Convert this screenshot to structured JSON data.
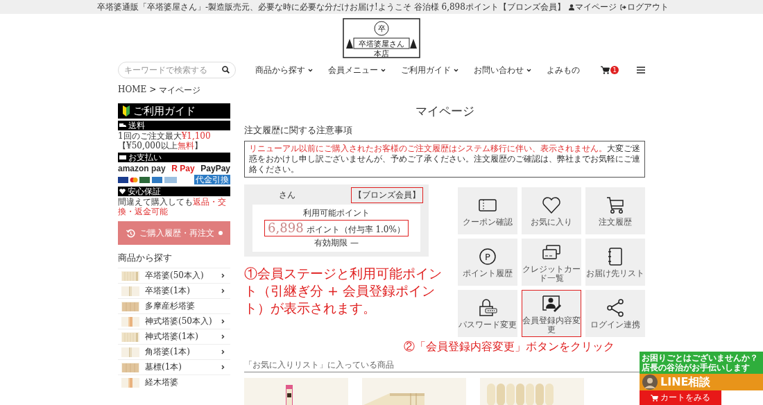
{
  "top_bar": {
    "tagline": "卒塔婆通販「卒塔婆屋さん」-製造販売元、必要な時に必要な分だけお届け!",
    "welcome": "ようこそ 谷治様 6,898ポイント【ブロンズ会員】",
    "links": [
      "マイページ",
      "ログアウト"
    ]
  },
  "logo": {
    "mark": "卒",
    "name": "卒塔婆屋さん",
    "branch": "本店"
  },
  "search": {
    "placeholder": "キーワードで検索する"
  },
  "nav": [
    {
      "label": "商品から探す",
      "dropdown": true
    },
    {
      "label": "会員メニュー",
      "dropdown": true
    },
    {
      "label": "ご利用ガイド",
      "dropdown": true
    },
    {
      "label": "お問い合わせ",
      "dropdown": true
    },
    {
      "label": "よみもの",
      "dropdown": false
    }
  ],
  "cart": {
    "count": "1"
  },
  "breadcrumb": {
    "items": [
      "HOME",
      "マイページ"
    ],
    "separator": ">"
  },
  "guide": {
    "title": "ご利用ガイド",
    "sections": [
      {
        "kind": "text",
        "heading": "送料",
        "segments": [
          {
            "text": "1回のご注文最大",
            "red": false
          },
          {
            "text": "¥1,100",
            "red": true
          },
          {
            "text": "【¥50,000以上",
            "red": false
          },
          {
            "text": "無料",
            "red": true
          },
          {
            "text": "】",
            "red": false
          }
        ]
      },
      {
        "kind": "payments",
        "heading": "お支払い",
        "wallets": [
          "amazon pay",
          "R Pay",
          "PayPay"
        ],
        "cod": "代金引換"
      },
      {
        "kind": "text",
        "heading": "安心保証",
        "segments": [
          {
            "text": "間違えて購入しても",
            "red": false
          },
          {
            "text": "返品・交換・返金可能",
            "red": true
          }
        ]
      }
    ]
  },
  "reorder_button": "ご購入履歴・再注文",
  "categories": {
    "heading": "商品から探す",
    "items": [
      {
        "name": "卒塔婆(50本入)",
        "arrow": true
      },
      {
        "name": "卒塔婆(1本)",
        "arrow": true
      },
      {
        "name": "多摩産杉塔婆",
        "arrow": false
      },
      {
        "name": "神式塔婆(50本入)",
        "arrow": true
      },
      {
        "name": "神式塔婆(1本)",
        "arrow": true
      },
      {
        "name": "角塔婆(1本)",
        "arrow": true
      },
      {
        "name": "墓標(1本)",
        "arrow": true
      },
      {
        "name": "経木塔婆",
        "arrow": false
      }
    ]
  },
  "page_title": "マイページ",
  "notice": {
    "heading": "注文履歴に関する注意事項",
    "segments": [
      {
        "text": "リニューアル以前にご購入されたお客様のご注文履歴はシステム移行に伴い、表示されません。",
        "red": true
      },
      {
        "text": "大変ご迷惑をおかけし申し訳ございませんが、予めご了承ください。注文履歴のご確認は、弊社までお気軽にご連絡ください。",
        "red": false
      }
    ]
  },
  "member": {
    "name_suffix": "さん",
    "rank": "【ブロンズ会員】",
    "rank_highlighted": true,
    "points_label": "利用可能ポイント",
    "points": "6,898",
    "points_highlighted": true,
    "points_unit": "ポイント（付与率 1.0%）",
    "expiry": "有効期限 —"
  },
  "tiles": [
    {
      "label": "クーポン確認",
      "highlighted": false
    },
    {
      "label": "お気に入り",
      "highlighted": false
    },
    {
      "label": "注文履歴",
      "highlighted": false
    },
    {
      "label": "ポイント履歴",
      "glyph": "P",
      "highlighted": false
    },
    {
      "label": "クレジットカード一覧",
      "highlighted": false
    },
    {
      "label": "お届け先リスト",
      "highlighted": false
    },
    {
      "label": "パスワード変更",
      "highlighted": false
    },
    {
      "label": "会員登録内容変更",
      "highlighted": true
    },
    {
      "label": "ログイン連携",
      "highlighted": false
    }
  ],
  "annotations": [
    "①会員ステージと利用可能ポイント（引継ぎ分 + 会員登録ポイント）が表示されます。",
    "②「会員登録内容変更」ボタンをクリック"
  ],
  "favorites": {
    "heading": "「お気に入りリスト」に入っている商品"
  },
  "line_widget": {
    "lines": [
      "お困りごとはございませんか？",
      "店長の谷治がお手伝いします"
    ],
    "title": "LINE相談",
    "cart_button": "カートをみる"
  }
}
